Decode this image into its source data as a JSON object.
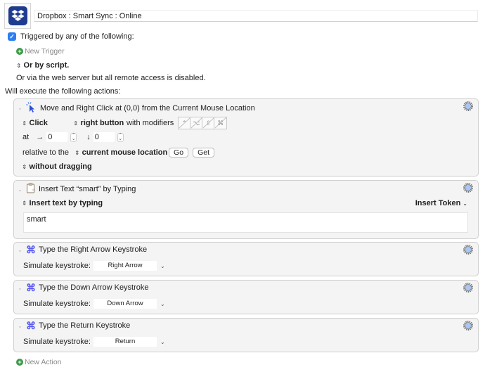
{
  "macro": {
    "name": "Dropbox : Smart Sync : Online",
    "icon": "dropbox-icon"
  },
  "triggers": {
    "enabled": true,
    "label": "Triggered by any of the following:",
    "new_trigger": "New Trigger",
    "or_by_script": "Or by script.",
    "web_server_note": "Or via the web server but all remote access is disabled."
  },
  "actions_heading": "Will execute the following actions:",
  "actions": [
    {
      "title": "Move and Right Click at (0,0) from the Current Mouse Location",
      "icon": "mouse-click-icon",
      "click_type": "Click",
      "button": "right button",
      "with_modifiers_label": "with modifiers",
      "modifiers": [
        "control",
        "option",
        "shift",
        "command"
      ],
      "modifier_glyphs": [
        "⌃",
        "⌥",
        "⇧",
        "⌘"
      ],
      "at_label": "at",
      "x_arrow": "→",
      "x_value": "0",
      "y_arrow": "↓",
      "y_value": "0",
      "relative_label": "relative to the",
      "relative_to": "current mouse location",
      "go_label": "Go",
      "get_label": "Get",
      "drag_mode": "without dragging"
    },
    {
      "title": "Insert Text “smart” by Typing",
      "icon": "clipboard-icon",
      "mode": "Insert text by typing",
      "insert_token": "Insert Token",
      "text": "smart"
    },
    {
      "title": "Type the Right Arrow Keystroke",
      "icon": "command-key-icon",
      "label": "Simulate keystroke:",
      "key": "Right Arrow"
    },
    {
      "title": "Type the Down Arrow Keystroke",
      "icon": "command-key-icon",
      "label": "Simulate keystroke:",
      "key": "Down Arrow"
    },
    {
      "title": "Type the Return Keystroke",
      "icon": "command-key-icon",
      "label": "Simulate keystroke:",
      "key": "Return"
    }
  ],
  "new_action": "New Action",
  "glyphs": {
    "checkmark": "✓",
    "plus": "+",
    "updown": "⬍",
    "disclosure": "⌄",
    "chevron": "⌄",
    "command": "⌘"
  }
}
